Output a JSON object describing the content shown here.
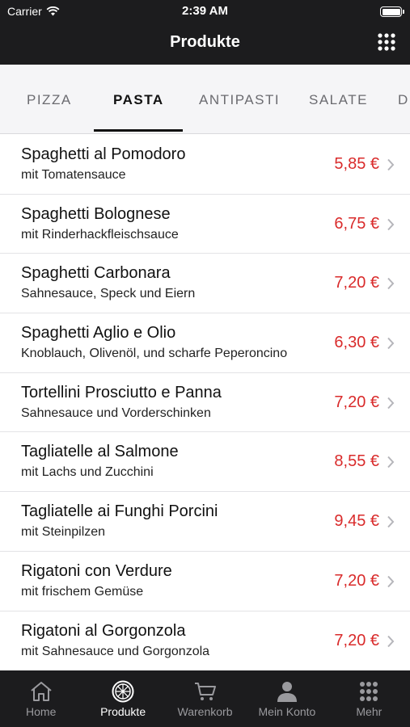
{
  "status_bar": {
    "carrier": "Carrier",
    "time": "2:39 AM"
  },
  "header": {
    "title": "Produkte",
    "menu_icon": "grid-icon"
  },
  "category_tabs": [
    {
      "label": "PIZZA",
      "active": false
    },
    {
      "label": "PASTA",
      "active": true
    },
    {
      "label": "ANTIPASTI",
      "active": false
    },
    {
      "label": "SALATE",
      "active": false
    },
    {
      "label": "D",
      "active": false
    }
  ],
  "products": [
    {
      "name": "Spaghetti al Pomodoro",
      "description": "mit Tomatensauce",
      "price": "5,85 €"
    },
    {
      "name": "Spaghetti Bolognese",
      "description": "mit Rinderhackfleischsauce",
      "price": "6,75 €"
    },
    {
      "name": "Spaghetti Carbonara",
      "description": "Sahnesauce, Speck und Eiern",
      "price": "7,20 €"
    },
    {
      "name": "Spaghetti Aglio e Olio",
      "description": "Knoblauch, Olivenöl, und scharfe Peperoncino",
      "price": "6,30 €"
    },
    {
      "name": "Tortellini Prosciutto e Panna",
      "description": "Sahnesauce und Vorderschinken",
      "price": "7,20 €"
    },
    {
      "name": "Tagliatelle al Salmone",
      "description": "mit Lachs und Zucchini",
      "price": "8,55 €"
    },
    {
      "name": "Tagliatelle ai Funghi Porcini",
      "description": "mit Steinpilzen",
      "price": "9,45 €"
    },
    {
      "name": "Rigatoni con Verdure",
      "description": "mit frischem Gemüse",
      "price": "7,20 €"
    },
    {
      "name": "Rigatoni al Gorgonzola",
      "description": "mit Sahnesauce und Gorgonzola",
      "price": "7,20 €"
    }
  ],
  "tab_bar": [
    {
      "label": "Home",
      "icon": "home-icon",
      "active": false
    },
    {
      "label": "Produkte",
      "icon": "pizza-icon",
      "active": true
    },
    {
      "label": "Warenkorb",
      "icon": "cart-icon",
      "active": false
    },
    {
      "label": "Mein Konto",
      "icon": "user-icon",
      "active": false
    },
    {
      "label": "Mehr",
      "icon": "grid-icon",
      "active": false
    }
  ],
  "colors": {
    "bar_background": "#1c1c1e",
    "price": "#d92b2b",
    "tab_background": "#f5f5f7",
    "inactive_tab": "#9a9a9e"
  }
}
